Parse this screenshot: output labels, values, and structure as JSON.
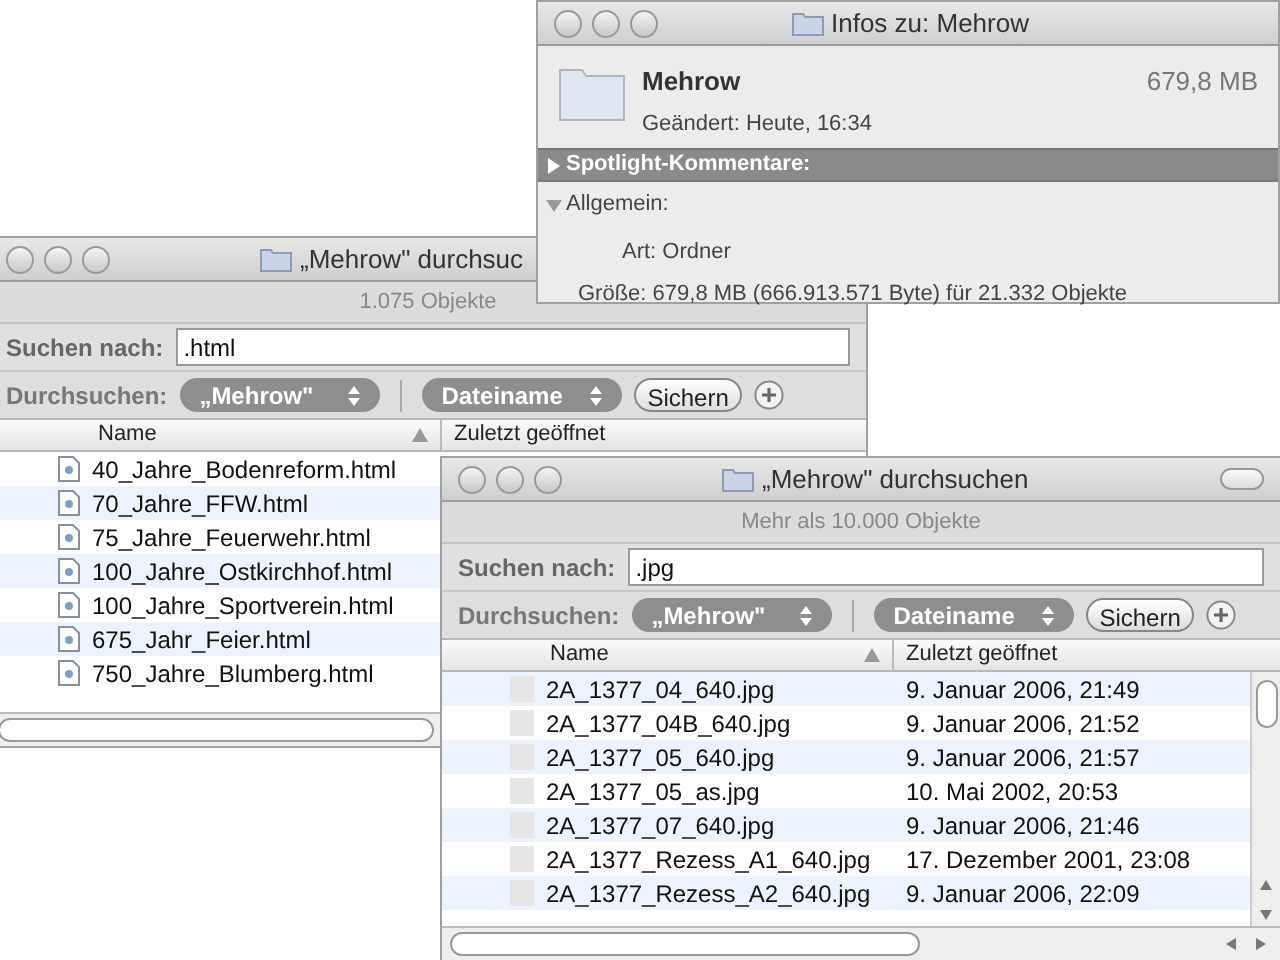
{
  "info_window": {
    "title": "Infos zu: Mehrow",
    "name": "Mehrow",
    "modified": "Geändert: Heute, 16:34",
    "size": "679,8 MB",
    "sections": [
      {
        "label": "Spotlight-Kommentare:",
        "expanded": false,
        "selected": true
      },
      {
        "label": "Allgemein:",
        "expanded": true,
        "selected": false
      }
    ],
    "details": [
      "Art: Ordner",
      "Größe: 679,8 MB (666.913.571 Byte) für 21.332 Objekte"
    ]
  },
  "search_windows": [
    {
      "title": "„Mehrow\" durchsuc",
      "status": "1.075 Objekte",
      "search_label": "Suchen nach:",
      "search_value": ".html",
      "scope_label": "Durchsuchen:",
      "scope": "„Mehrow\"",
      "criterion": "Dateiname",
      "save": "Sichern",
      "columns": [
        "Name",
        "Zuletzt geöffnet"
      ],
      "rows": [
        {
          "name": "40_Jahre_Bodenreform.html"
        },
        {
          "name": "70_Jahre_FFW.html"
        },
        {
          "name": "75_Jahre_Feuerwehr.html"
        },
        {
          "name": "100_Jahre_Ostkirchhof.html"
        },
        {
          "name": "100_Jahre_Sportverein.html"
        },
        {
          "name": "675_Jahr_Feier.html"
        },
        {
          "name": "750_Jahre_Blumberg.html"
        }
      ]
    },
    {
      "title": "„Mehrow\" durchsuchen",
      "status": "Mehr als 10.000 Objekte",
      "search_label": "Suchen nach:",
      "search_value": ".jpg",
      "scope_label": "Durchsuchen:",
      "scope": "„Mehrow\"",
      "criterion": "Dateiname",
      "save": "Sichern",
      "columns": [
        "Name",
        "Zuletzt geöffnet"
      ],
      "rows": [
        {
          "name": "2A_1377_04_640.jpg",
          "date": "9. Januar 2006, 21:49"
        },
        {
          "name": "2A_1377_04B_640.jpg",
          "date": "9. Januar 2006, 21:52"
        },
        {
          "name": "2A_1377_05_640.jpg",
          "date": "9. Januar 2006, 21:57"
        },
        {
          "name": "2A_1377_05_as.jpg",
          "date": "10. Mai 2002, 20:53"
        },
        {
          "name": "2A_1377_07_640.jpg",
          "date": "9. Januar 2006, 21:46"
        },
        {
          "name": "2A_1377_Rezess_A1_640.jpg",
          "date": "17. Dezember 2001, 23:08"
        },
        {
          "name": "2A_1377_Rezess_A2_640.jpg",
          "date": "9. Januar 2006, 22:09"
        }
      ]
    }
  ]
}
